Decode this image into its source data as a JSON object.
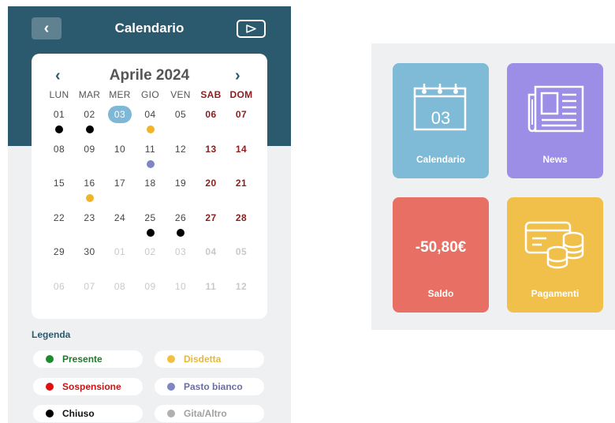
{
  "calendar_screen": {
    "header": {
      "title": "Calendario",
      "back_icon": "‹"
    },
    "month_nav": {
      "prev_icon": "‹",
      "title": "Aprile 2024",
      "next_icon": "›"
    },
    "weekdays": [
      "LUN",
      "MAR",
      "MER",
      "GIO",
      "VEN",
      "SAB",
      "DOM"
    ],
    "weeks": [
      [
        {
          "d": "01",
          "dot": "#000000"
        },
        {
          "d": "02",
          "dot": "#000000"
        },
        {
          "d": "03",
          "today": true
        },
        {
          "d": "04",
          "dot": "#f0b429"
        },
        {
          "d": "05"
        },
        {
          "d": "06"
        },
        {
          "d": "07"
        }
      ],
      [
        {
          "d": "08"
        },
        {
          "d": "09"
        },
        {
          "d": "10"
        },
        {
          "d": "11",
          "dot": "#7f86c3"
        },
        {
          "d": "12"
        },
        {
          "d": "13"
        },
        {
          "d": "14"
        }
      ],
      [
        {
          "d": "15"
        },
        {
          "d": "16",
          "dot": "#f0b429"
        },
        {
          "d": "17"
        },
        {
          "d": "18"
        },
        {
          "d": "19"
        },
        {
          "d": "20"
        },
        {
          "d": "21"
        }
      ],
      [
        {
          "d": "22"
        },
        {
          "d": "23"
        },
        {
          "d": "24"
        },
        {
          "d": "25",
          "dot": "#000000"
        },
        {
          "d": "26",
          "dot": "#000000"
        },
        {
          "d": "27"
        },
        {
          "d": "28"
        }
      ],
      [
        {
          "d": "29"
        },
        {
          "d": "30"
        },
        {
          "d": "01",
          "other": true
        },
        {
          "d": "02",
          "other": true
        },
        {
          "d": "03",
          "other": true
        },
        {
          "d": "04",
          "other": true
        },
        {
          "d": "05",
          "other": true
        }
      ],
      [
        {
          "d": "06",
          "other": true
        },
        {
          "d": "07",
          "other": true
        },
        {
          "d": "08",
          "other": true
        },
        {
          "d": "09",
          "other": true
        },
        {
          "d": "10",
          "other": true
        },
        {
          "d": "11",
          "other": true
        },
        {
          "d": "12",
          "other": true
        }
      ]
    ],
    "legend": {
      "title": "Legenda",
      "items": [
        {
          "label": "Presente",
          "dot": "#1e8a2e",
          "color": "#1e7a2a"
        },
        {
          "label": "Disdetta",
          "dot": "#f0c040",
          "color": "#e8b830"
        },
        {
          "label": "Sospensione",
          "dot": "#e01010",
          "color": "#c01818"
        },
        {
          "label": "Pasto bianco",
          "dot": "#7f86c3",
          "color": "#6a6f9e"
        },
        {
          "label": "Chiuso",
          "dot": "#000000",
          "color": "#111111"
        },
        {
          "label": "Gita/Altro",
          "dot": "#b0b0b0",
          "color": "#a0a0a0"
        }
      ]
    }
  },
  "dashboard": {
    "tiles": [
      {
        "name": "calendario",
        "label": "Calendario",
        "icon": "calendar-icon",
        "icon_text": "03",
        "color": "#7fbbd6"
      },
      {
        "name": "news",
        "label": "News",
        "icon": "newspaper-icon",
        "color": "#9c8ee6"
      },
      {
        "name": "saldo",
        "label": "Saldo",
        "value": "-50,80€",
        "color": "#e86f63"
      },
      {
        "name": "pagamenti",
        "label": "Pagamenti",
        "icon": "payments-icon",
        "color": "#f0c04a"
      }
    ]
  }
}
